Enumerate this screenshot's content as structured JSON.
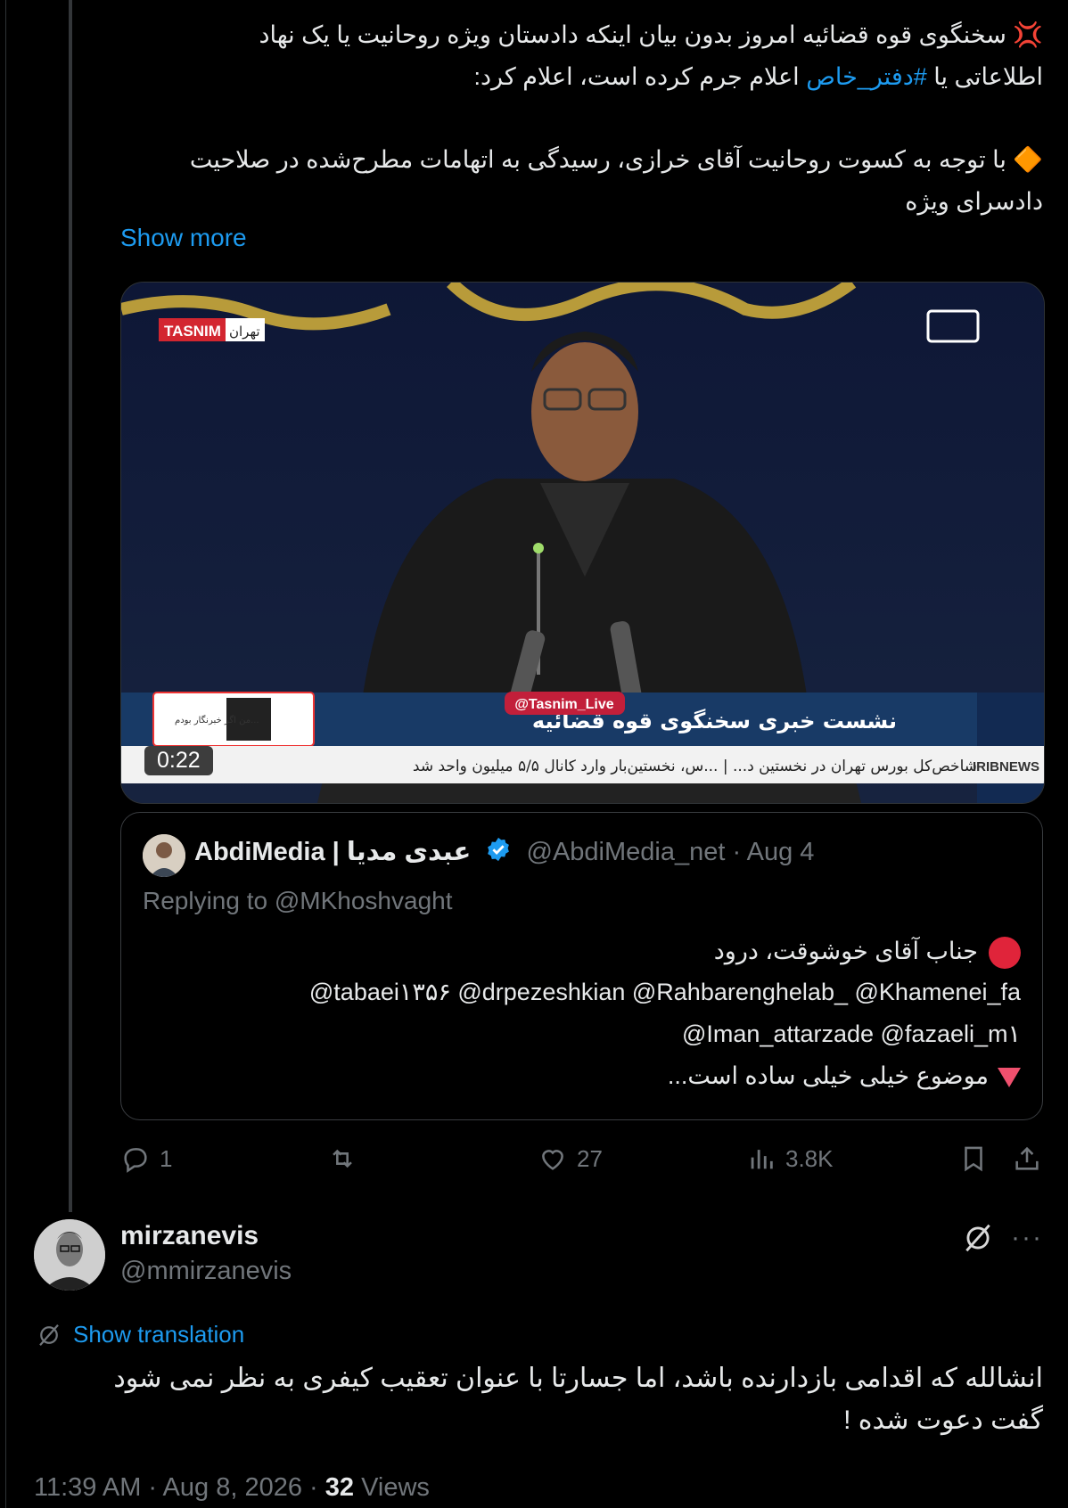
{
  "tweet": {
    "line1": "💢 سخنگوی قوه قضائیه امروز بدون بیان اینکه دادستان ویژه روحانیت یا یک نهاد",
    "line2_prefix": "اطلاعاتی یا",
    "hashtag": "#دفتر_خاص",
    "line2_suffix": "اعلام جرم کرده است، اعلام کرد:",
    "line3": "🔶 با توجه به کسوت روحانیت آقای خرازی، رسیدگی به اتهامات مطرح‌شده در صلاحیت",
    "line4": "دادسرای ویژه",
    "show_more": "Show more"
  },
  "video": {
    "duration": "0:22",
    "overlay_channel": "TASNIM",
    "overlay_city": "تهران",
    "overlay_handle": "@Tasnim_Live",
    "overlay_title": "نشست خبری سخنگوی قوه قضائیه",
    "overlay_ticker": "شاخص‌کل بورس تهران در نخستین د... | ...س، نخستین‌بار وارد کانال ۵/۵ میلیون واحد شد",
    "overlay_network": "IRIBNEWS",
    "overlay_badge": "من اگر خبرنگار بودم..."
  },
  "quote": {
    "name": "AbdiMedia | عبدی مدیا",
    "handle": "@AbdiMedia_net",
    "date": "· Aug 4",
    "replying_to": "Replying to @MKhoshvaght",
    "line1": "جناب آقای خوشوقت، درود",
    "line2": "@tabaei۱۳۵۶ @drpezeshkian @Rahbarenghelab_ @Khamenei_fa",
    "line3": "@Iman_attarzade @fazaeli_m۱",
    "line4": "موضوع خیلی خیلی ساده است..."
  },
  "actions": {
    "replies": "1",
    "reposts": "",
    "likes": "27",
    "views": "3.8K"
  },
  "reply": {
    "name": "mirzanevis",
    "handle": "@mmirzanevis",
    "show_translation": "Show translation",
    "text_line1": "انشالله که اقدامی بازدارنده باشد،  اما جسارتا با عنوان تعقیب کیفری به نظر نمی شود",
    "text_line2": "گفت دعوت شده !",
    "time": "11:39 AM · Aug 8, 2026 ·",
    "views_count": "32",
    "views_label": "Views"
  },
  "colors": {
    "accent": "#1d9bf0",
    "muted": "#71767b",
    "background": "#000000"
  }
}
